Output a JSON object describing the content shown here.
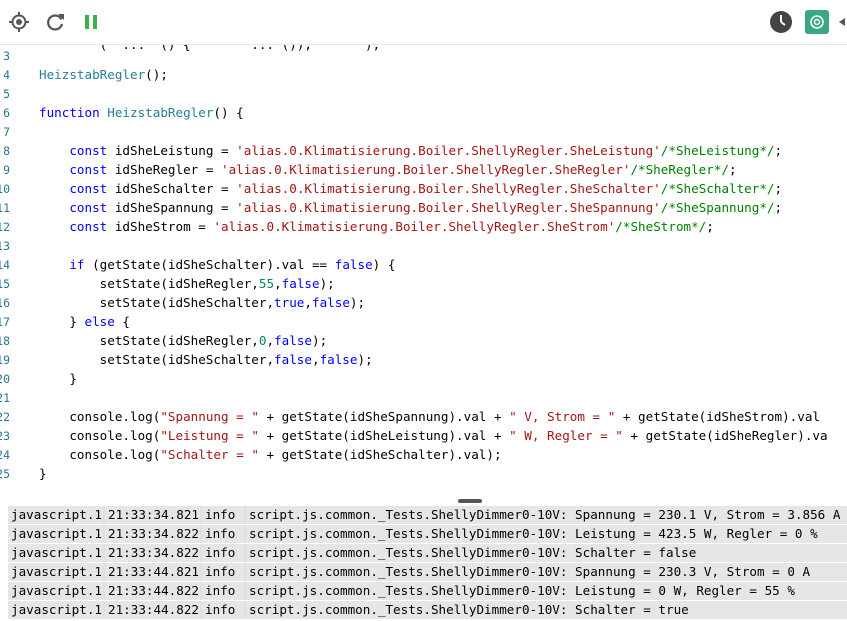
{
  "toolbar": {
    "icons": [
      "locate-icon",
      "reload-icon",
      "pause-icon",
      "clock-icon",
      "chatgpt-icon",
      "caret-left-icon"
    ],
    "colors": {
      "pause": "#3cb04b",
      "clock": "#444444",
      "chatgpt_bg": "#3aa77e"
    }
  },
  "editor": {
    "lines": [
      {
        "n": "3",
        "tokens": []
      },
      {
        "n": "4",
        "tokens": [
          {
            "c": "fn",
            "t": "HeizstabRegler"
          },
          {
            "c": "",
            "t": "();"
          }
        ]
      },
      {
        "n": "5",
        "tokens": []
      },
      {
        "n": "6",
        "tokens": [
          {
            "c": "kw",
            "t": "function"
          },
          {
            "c": "",
            "t": " "
          },
          {
            "c": "fn",
            "t": "HeizstabRegler"
          },
          {
            "c": "",
            "t": "() {"
          }
        ]
      },
      {
        "n": "7",
        "tokens": []
      },
      {
        "n": "8",
        "tokens": [
          {
            "c": "",
            "t": "    "
          },
          {
            "c": "kw",
            "t": "const"
          },
          {
            "c": "",
            "t": " idSheLeistung = "
          },
          {
            "c": "str",
            "t": "'alias.0.Klimatisierung.Boiler.ShellyRegler.SheLeistung'"
          },
          {
            "c": "cm",
            "t": "/*SheLeistung*/"
          },
          {
            "c": "",
            "t": ";"
          }
        ]
      },
      {
        "n": "9",
        "tokens": [
          {
            "c": "",
            "t": "    "
          },
          {
            "c": "kw",
            "t": "const"
          },
          {
            "c": "",
            "t": " idSheRegler = "
          },
          {
            "c": "str",
            "t": "'alias.0.Klimatisierung.Boiler.ShellyRegler.SheRegler'"
          },
          {
            "c": "cm",
            "t": "/*SheRegler*/"
          },
          {
            "c": "",
            "t": ";"
          }
        ]
      },
      {
        "n": "10",
        "tokens": [
          {
            "c": "",
            "t": "    "
          },
          {
            "c": "kw",
            "t": "const"
          },
          {
            "c": "",
            "t": " idSheSchalter = "
          },
          {
            "c": "str",
            "t": "'alias.0.Klimatisierung.Boiler.ShellyRegler.SheSchalter'"
          },
          {
            "c": "cm",
            "t": "/*SheSchalter*/"
          },
          {
            "c": "",
            "t": ";"
          }
        ]
      },
      {
        "n": "11",
        "tokens": [
          {
            "c": "",
            "t": "    "
          },
          {
            "c": "kw",
            "t": "const"
          },
          {
            "c": "",
            "t": " idSheSpannung = "
          },
          {
            "c": "str",
            "t": "'alias.0.Klimatisierung.Boiler.ShellyRegler.SheSpannung'"
          },
          {
            "c": "cm",
            "t": "/*SheSpannung*/"
          },
          {
            "c": "",
            "t": ";"
          }
        ]
      },
      {
        "n": "12",
        "tokens": [
          {
            "c": "",
            "t": "    "
          },
          {
            "c": "kw",
            "t": "const"
          },
          {
            "c": "",
            "t": " idSheStrom = "
          },
          {
            "c": "str",
            "t": "'alias.0.Klimatisierung.Boiler.ShellyRegler.SheStrom'"
          },
          {
            "c": "cm",
            "t": "/*SheStrom*/"
          },
          {
            "c": "",
            "t": ";"
          }
        ]
      },
      {
        "n": "13",
        "tokens": []
      },
      {
        "n": "14",
        "tokens": [
          {
            "c": "",
            "t": "    "
          },
          {
            "c": "kw",
            "t": "if"
          },
          {
            "c": "",
            "t": " (getState(idSheSchalter).val == "
          },
          {
            "c": "kw",
            "t": "false"
          },
          {
            "c": "",
            "t": ") {"
          }
        ]
      },
      {
        "n": "15",
        "tokens": [
          {
            "c": "",
            "t": "        setState(idSheRegler,"
          },
          {
            "c": "num",
            "t": "55"
          },
          {
            "c": "",
            "t": ","
          },
          {
            "c": "kw",
            "t": "false"
          },
          {
            "c": "",
            "t": ");"
          }
        ]
      },
      {
        "n": "16",
        "tokens": [
          {
            "c": "",
            "t": "        setState(idSheSchalter,"
          },
          {
            "c": "kw",
            "t": "true"
          },
          {
            "c": "",
            "t": ","
          },
          {
            "c": "kw",
            "t": "false"
          },
          {
            "c": "",
            "t": ");"
          }
        ]
      },
      {
        "n": "17",
        "tokens": [
          {
            "c": "",
            "t": "    } "
          },
          {
            "c": "kw",
            "t": "else"
          },
          {
            "c": "",
            "t": " {"
          }
        ]
      },
      {
        "n": "18",
        "tokens": [
          {
            "c": "",
            "t": "        setState(idSheRegler,"
          },
          {
            "c": "num",
            "t": "0"
          },
          {
            "c": "",
            "t": ","
          },
          {
            "c": "kw",
            "t": "false"
          },
          {
            "c": "",
            "t": ");"
          }
        ]
      },
      {
        "n": "19",
        "tokens": [
          {
            "c": "",
            "t": "        setState(idSheSchalter,"
          },
          {
            "c": "kw",
            "t": "false"
          },
          {
            "c": "",
            "t": ","
          },
          {
            "c": "kw",
            "t": "false"
          },
          {
            "c": "",
            "t": ");"
          }
        ]
      },
      {
        "n": "20",
        "tokens": [
          {
            "c": "",
            "t": "    }"
          }
        ]
      },
      {
        "n": "21",
        "tokens": []
      },
      {
        "n": "22",
        "tokens": [
          {
            "c": "",
            "t": "    console.log("
          },
          {
            "c": "str",
            "t": "\"Spannung = \""
          },
          {
            "c": "",
            "t": " + getState(idSheSpannung).val + "
          },
          {
            "c": "str",
            "t": "\" V, Strom = \""
          },
          {
            "c": "",
            "t": " + getState(idSheStrom).val"
          }
        ]
      },
      {
        "n": "23",
        "tokens": [
          {
            "c": "",
            "t": "    console.log("
          },
          {
            "c": "str",
            "t": "\"Leistung = \""
          },
          {
            "c": "",
            "t": " + getState(idSheLeistung).val + "
          },
          {
            "c": "str",
            "t": "\" W, Regler = \""
          },
          {
            "c": "",
            "t": " + getState(idSheRegler).va"
          }
        ]
      },
      {
        "n": "24",
        "tokens": [
          {
            "c": "",
            "t": "    console.log("
          },
          {
            "c": "str",
            "t": "\"Schalter = \""
          },
          {
            "c": "",
            "t": " + getState(idSheSchalter).val);"
          }
        ]
      },
      {
        "n": "25",
        "tokens": [
          {
            "c": "",
            "t": "}"
          }
        ]
      }
    ]
  },
  "logs": [
    {
      "source": "javascript.1",
      "time": "21:33:34.821",
      "level": "info",
      "message": "script.js.common._Tests.ShellyDimmer0-10V: Spannung = 230.1 V, Strom = 3.856 A"
    },
    {
      "source": "javascript.1",
      "time": "21:33:34.822",
      "level": "info",
      "message": "script.js.common._Tests.ShellyDimmer0-10V: Leistung = 423.5 W, Regler = 0 %"
    },
    {
      "source": "javascript.1",
      "time": "21:33:34.822",
      "level": "info",
      "message": "script.js.common._Tests.ShellyDimmer0-10V: Schalter = false"
    },
    {
      "source": "javascript.1",
      "time": "21:33:44.821",
      "level": "info",
      "message": "script.js.common._Tests.ShellyDimmer0-10V: Spannung = 230.3 V, Strom = 0 A"
    },
    {
      "source": "javascript.1",
      "time": "21:33:44.822",
      "level": "info",
      "message": "script.js.common._Tests.ShellyDimmer0-10V: Leistung = 0 W, Regler = 55 %"
    },
    {
      "source": "javascript.1",
      "time": "21:33:44.822",
      "level": "info",
      "message": "script.js.common._Tests.ShellyDimmer0-10V: Schalter = true"
    }
  ]
}
